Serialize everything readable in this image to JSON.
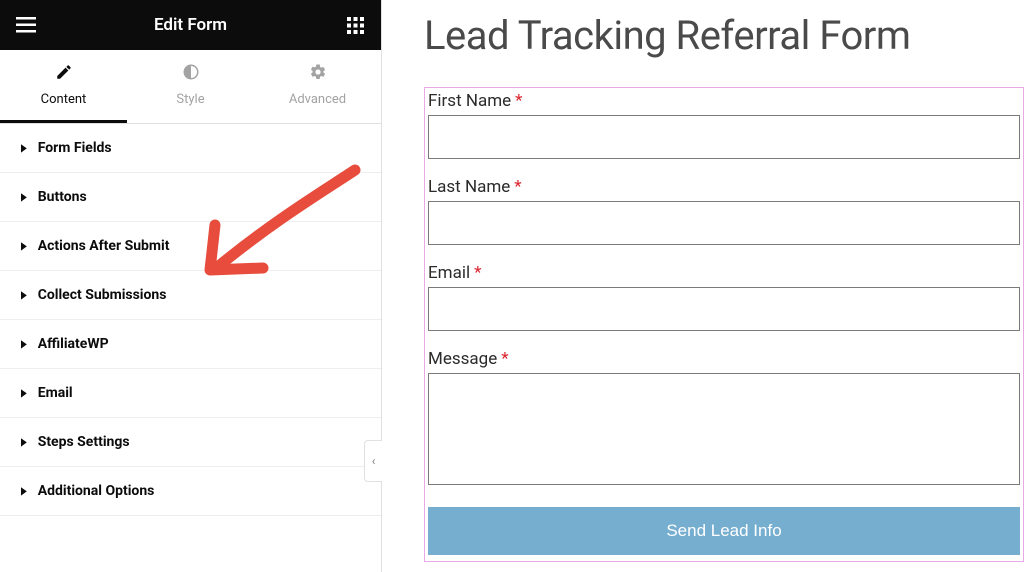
{
  "panel": {
    "title": "Edit Form",
    "tabs": [
      {
        "label": "Content",
        "icon": "pencil-icon",
        "active": true
      },
      {
        "label": "Style",
        "icon": "contrast-icon",
        "active": false
      },
      {
        "label": "Advanced",
        "icon": "gear-icon",
        "active": false
      }
    ],
    "sections": [
      "Form Fields",
      "Buttons",
      "Actions After Submit",
      "Collect Submissions",
      "AffiliateWP",
      "Email",
      "Steps Settings",
      "Additional Options"
    ]
  },
  "preview": {
    "form_title": "Lead Tracking Referral Form",
    "fields": [
      {
        "label": "First Name",
        "required": true,
        "type": "text"
      },
      {
        "label": "Last Name",
        "required": true,
        "type": "text"
      },
      {
        "label": "Email",
        "required": true,
        "type": "text"
      },
      {
        "label": "Message",
        "required": true,
        "type": "textarea"
      }
    ],
    "submit_label": "Send Lead Info"
  },
  "required_marker": "*"
}
